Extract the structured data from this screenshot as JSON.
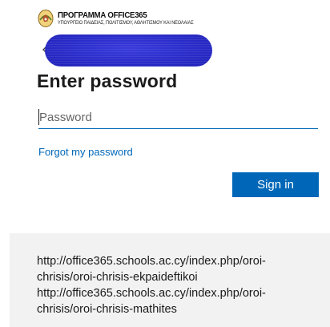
{
  "header": {
    "logo_title": "ΠΡΟΓΡΑΜΜΑ OFFICE365",
    "logo_subtitle": "ΥΠΟΥΡΓΕΙΟ ΠΑΙΔΕΙΑΣ, ΠΟΛΙΤΙΣΜΟΥ, ΑΘΛΗΤΙΣΜΟΥ ΚΑΙ ΝΕΟΛΑΙΑΣ",
    "emblem_icon": "cyprus-emblem-icon"
  },
  "identity": {
    "back_icon": "back-arrow-icon",
    "redaction_color": "#2a2cc9"
  },
  "form": {
    "title": "Enter password",
    "password_placeholder": "Password",
    "password_value": "",
    "forgot_link": "Forgot my password",
    "signin_label": "Sign in",
    "accent_color": "#0067b8"
  },
  "notice": {
    "lines": [
      "http://office365.schools.ac.cy/index.php/oroi-",
      "chrisis/oroi-chrisis-ekpaideftikoi",
      "http://office365.schools.ac.cy/index.php/oroi-",
      "chrisis/oroi-chrisis-mathites"
    ]
  }
}
